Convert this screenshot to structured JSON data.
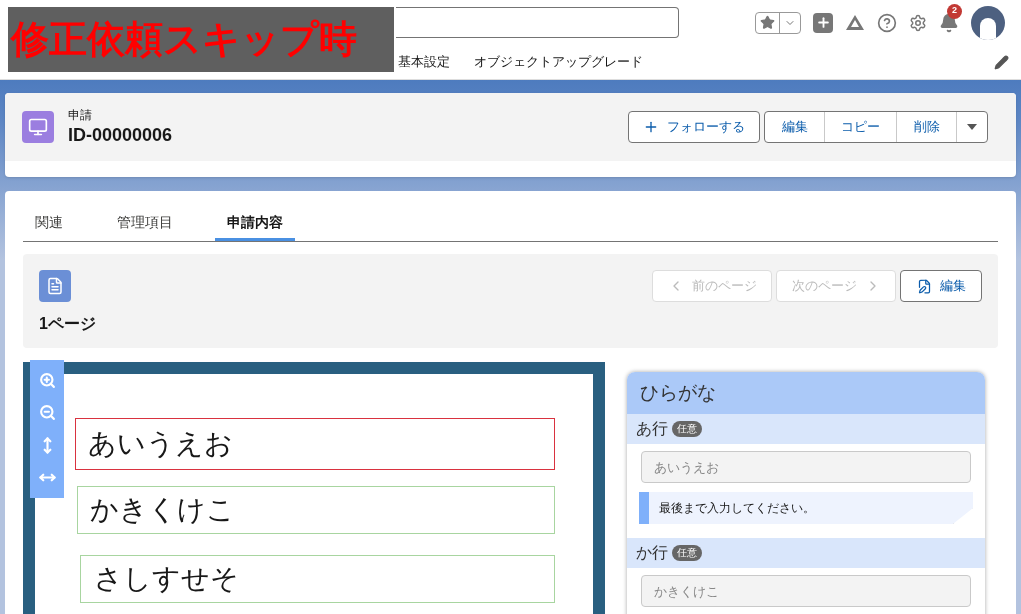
{
  "overlay_label": "修正依頼スキップ時",
  "header": {
    "notification_count": "2"
  },
  "nav": {
    "items": [
      "基本設定",
      "オブジェクトアップグレード"
    ]
  },
  "record": {
    "object": "申請",
    "title": "ID-00000006",
    "follow": "フォローする",
    "buttons": [
      "編集",
      "コピー",
      "削除"
    ]
  },
  "tabs": [
    {
      "label": "関連",
      "selected": false
    },
    {
      "label": "管理項目",
      "selected": false
    },
    {
      "label": "申請内容",
      "selected": true
    }
  ],
  "page_panel": {
    "title": "1ページ",
    "prev": {
      "label": "前のページ",
      "disabled": true
    },
    "next": {
      "label": "次のページ",
      "disabled": true
    },
    "edit": "編集"
  },
  "preview": {
    "fields": [
      {
        "value": "あいうえお",
        "invalid": true
      },
      {
        "value": "かきくけこ",
        "invalid": false
      },
      {
        "value": "さしすせそ",
        "invalid": false
      }
    ]
  },
  "form": {
    "title": "ひらがな",
    "sections": [
      {
        "label": "あ行",
        "badge": "任意",
        "placeholder": "あいうえお",
        "hint": "最後まで入力してください。"
      },
      {
        "label": "か行",
        "badge": "任意",
        "placeholder": "かきくけこ"
      }
    ]
  }
}
